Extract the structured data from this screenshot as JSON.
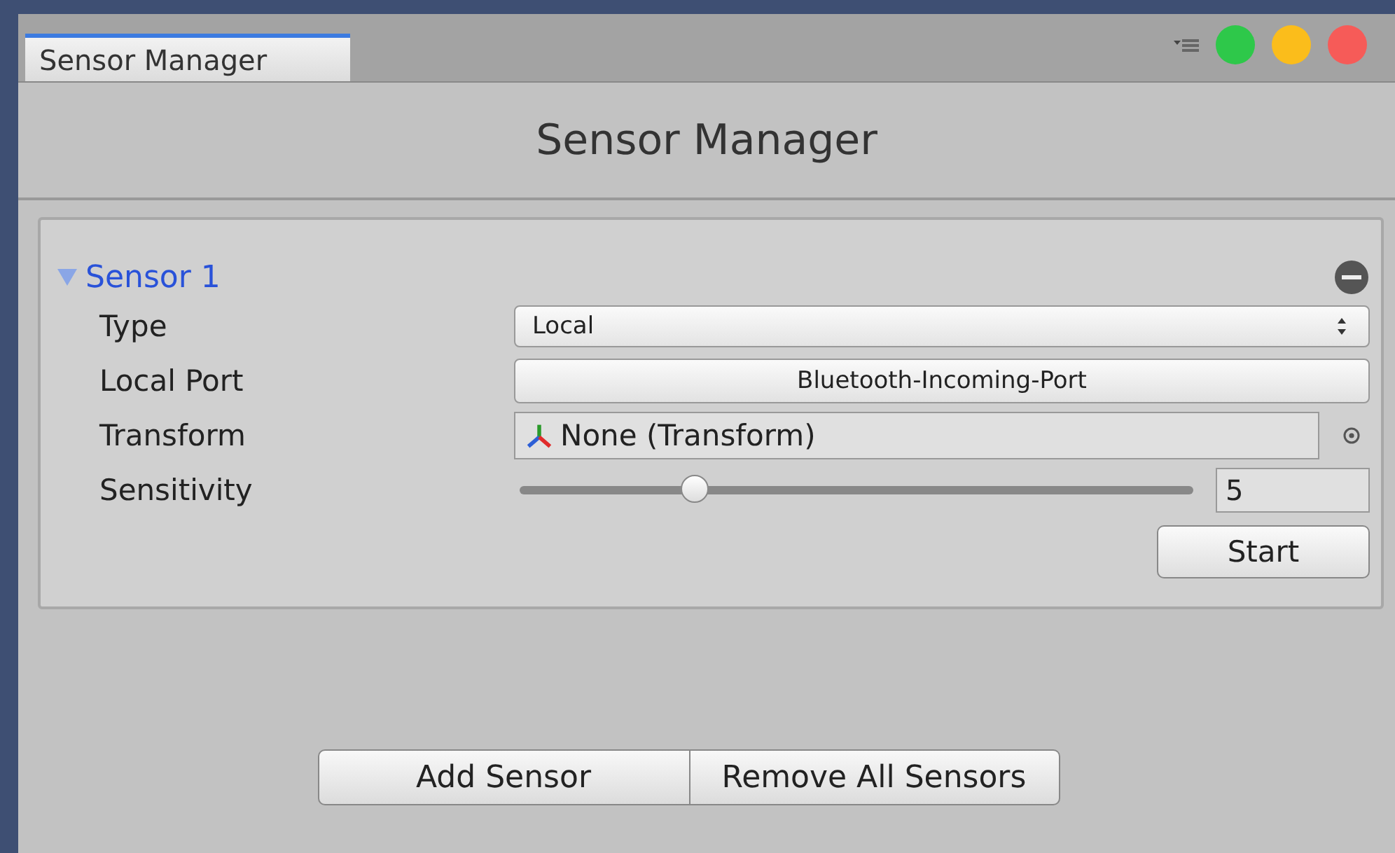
{
  "window": {
    "tab": "Sensor Manager",
    "title": "Sensor Manager"
  },
  "sensors": [
    {
      "name": "Sensor 1",
      "expanded": true,
      "fields": [
        {
          "kind": "dropdown",
          "label": "Type",
          "value": "Local"
        },
        {
          "kind": "button",
          "label": "Local Port",
          "value": "Bluetooth-Incoming-Port"
        },
        {
          "kind": "object",
          "label": "Transform",
          "value": "None (Transform)"
        },
        {
          "kind": "slider",
          "label": "Sensitivity",
          "level": 0.26,
          "value": "5"
        }
      ],
      "action": "Start"
    }
  ],
  "buttons": [
    "Add Sensor",
    "Remove All Sensors"
  ]
}
